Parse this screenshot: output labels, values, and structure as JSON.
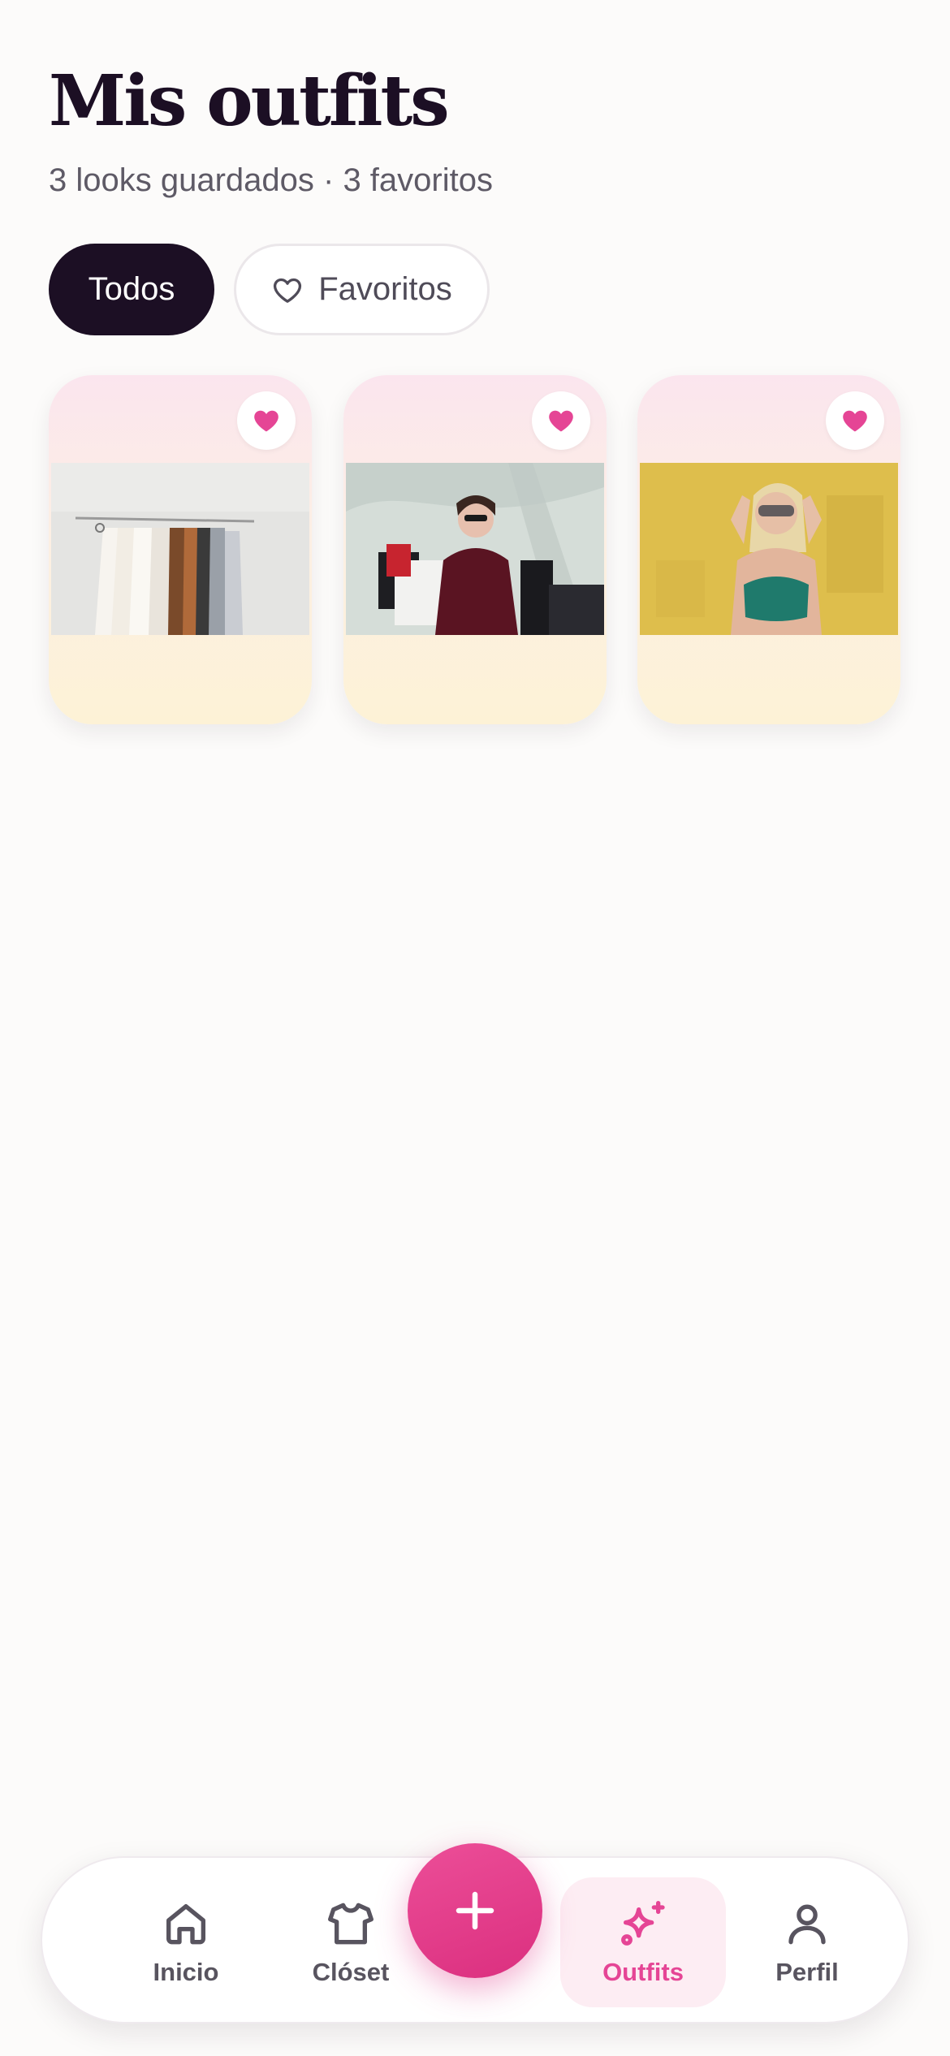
{
  "header": {
    "title": "Mis outfits",
    "subtitle": "3 looks guardados · 3 favoritos"
  },
  "filters": {
    "all_label": "Todos",
    "favorites_label": "Favoritos",
    "selected": "Todos"
  },
  "outfits": [
    {
      "image": "clothing-rack-photo",
      "favorite": true
    },
    {
      "image": "woman-with-shopping-bags-photo",
      "favorite": true
    },
    {
      "image": "woman-with-sunglasses-photo",
      "favorite": true
    }
  ],
  "tabbar": {
    "items": [
      {
        "label": "Inicio",
        "icon": "home-icon"
      },
      {
        "label": "Clóset",
        "icon": "shirt-icon"
      },
      {
        "label": "Outfits",
        "icon": "sparkles-icon",
        "active": true
      },
      {
        "label": "Perfil",
        "icon": "user-icon"
      }
    ],
    "fab_icon": "plus-icon"
  },
  "colors": {
    "accent": "#e54595",
    "dark": "#1c0f24",
    "background": "#fcfbfa"
  }
}
